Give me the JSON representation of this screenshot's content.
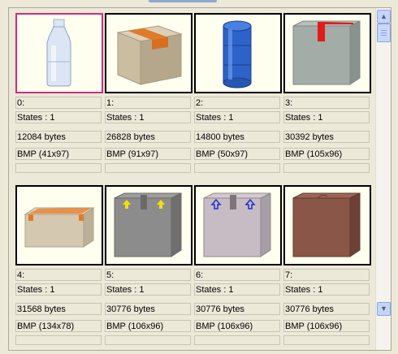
{
  "items": [
    {
      "index": "0:",
      "states": "States : 1",
      "size": "12084 bytes",
      "format": "BMP (41x97)",
      "extra": "",
      "icon": "plastic-bottle-icon",
      "selected": true
    },
    {
      "index": "1:",
      "states": "States : 1",
      "size": "26828 bytes",
      "format": "BMP (91x97)",
      "extra": "",
      "icon": "taped-cardboard-box-icon",
      "selected": false
    },
    {
      "index": "2:",
      "states": "States : 1",
      "size": "14800 bytes",
      "format": "BMP (50x97)",
      "extra": "",
      "icon": "blue-barrel-icon",
      "selected": false
    },
    {
      "index": "3:",
      "states": "States : 1",
      "size": "30392 bytes",
      "format": "BMP (105x96)",
      "extra": "",
      "icon": "gray-box-red-tape-icon",
      "selected": false
    },
    {
      "index": "4:",
      "states": "States : 1",
      "size": "31568 bytes",
      "format": "BMP (134x78)",
      "extra": "",
      "icon": "flat-box-orange-tape-icon",
      "selected": false
    },
    {
      "index": "5:",
      "states": "States : 1",
      "size": "30776 bytes",
      "format": "BMP (106x96)",
      "extra": "",
      "icon": "gray-box-yellow-arrows-icon",
      "selected": false
    },
    {
      "index": "6:",
      "states": "States : 1",
      "size": "30776 bytes",
      "format": "BMP (106x96)",
      "extra": "",
      "icon": "light-box-blue-arrows-icon",
      "selected": false
    },
    {
      "index": "7:",
      "states": "States : 1",
      "size": "30776 bytes",
      "format": "BMP (106x96)",
      "extra": "",
      "icon": "brown-box-icon",
      "selected": false
    }
  ],
  "scrollbar": {
    "up": "▲",
    "down": "▼"
  },
  "colors": {
    "selected_border": "#d12b7b",
    "thumb_bg": "#fffff0",
    "panel_bg": "#ece9d8"
  }
}
